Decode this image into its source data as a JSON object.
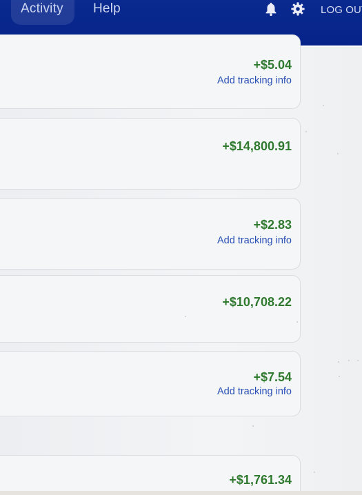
{
  "nav": {
    "activity_label": "Activity",
    "help_label": "Help",
    "bell_icon": "bell-icon",
    "gear_icon": "gear-icon",
    "logout_label": "LOG OUT",
    "bg_color": "#06238a"
  },
  "transactions": [
    {
      "amount": "+$5.04",
      "tracking": "Add tracking info"
    },
    {
      "amount": "+$14,800.91"
    },
    {
      "amount": "+$2.83",
      "tracking": "Add tracking info"
    },
    {
      "amount": "+$10,708.22"
    },
    {
      "amount": "+$7.54",
      "tracking": "Add tracking info"
    },
    {
      "amount": "+$1,761.34"
    }
  ],
  "colors": {
    "amount": "#2f7a2f",
    "link": "#2a4fb5"
  }
}
